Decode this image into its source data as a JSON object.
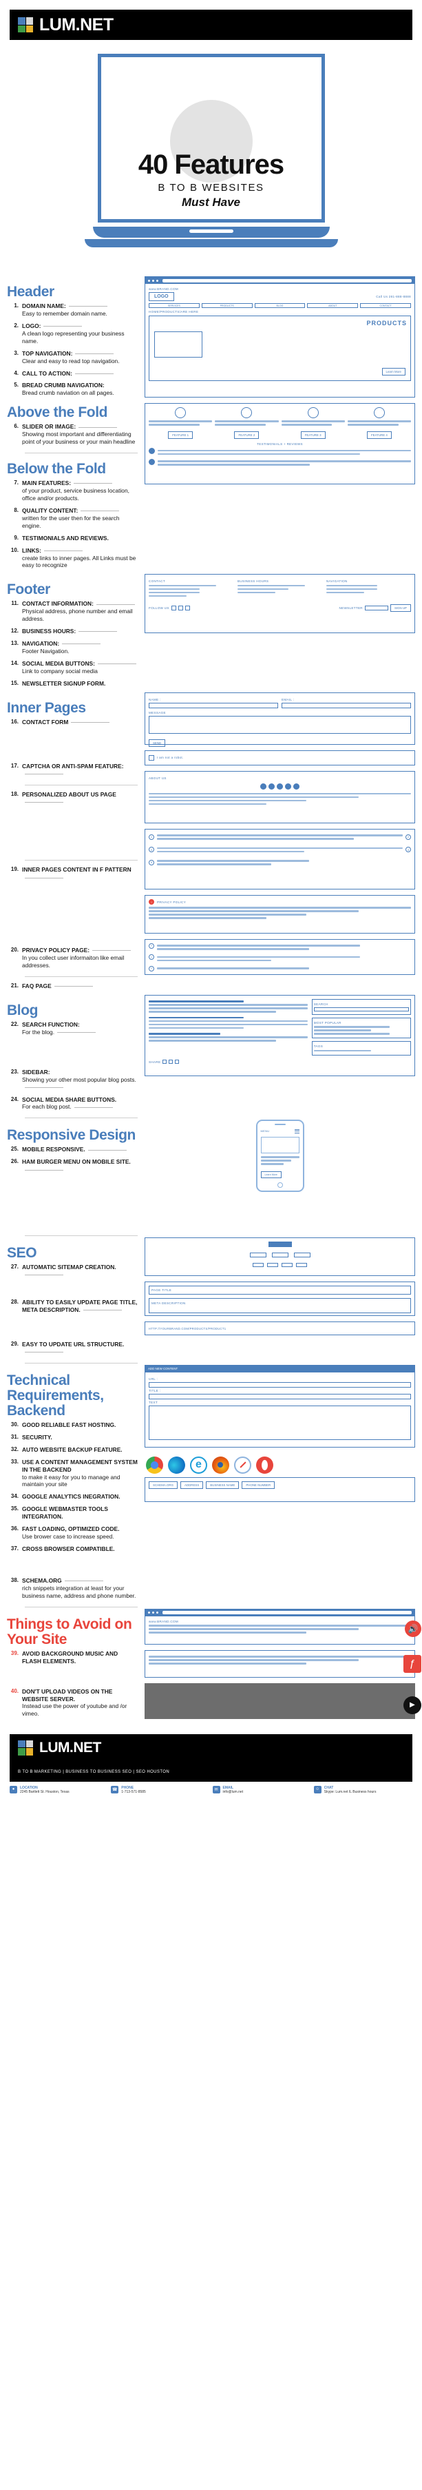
{
  "brand": {
    "name": "LUM.NET",
    "logo_icon": "lumnet-squares-logo",
    "tagline": "B TO B MARKETING | BUSINESS TO BUSINESS SEO | SEO HOUSTON"
  },
  "hero": {
    "title": "40 Features",
    "subtitle": "B TO B WEBSITES",
    "subtitle2": "Must Have"
  },
  "sections": [
    {
      "id": "header",
      "title": "Header",
      "items": [
        {
          "num": "1.",
          "title": "DOMAIN NAME:",
          "desc": "Easy to remember domain name."
        },
        {
          "num": "2.",
          "title": "LOGO:",
          "desc": "A clean logo representing your business name."
        },
        {
          "num": "3.",
          "title": "TOP NAVIGATION:",
          "desc": "Clear and easy to read top navigation."
        },
        {
          "num": "4.",
          "title": "CALL TO ACTION:",
          "desc": ""
        },
        {
          "num": "5.",
          "title": "BREAD CRUMB NAVIGATION:",
          "desc": "Bread crumb naviation on all pages."
        }
      ]
    },
    {
      "id": "above-the-fold",
      "title": "Above the Fold",
      "items": [
        {
          "num": "6.",
          "title": "SLIDER OR IMAGE:",
          "desc": "Showing most important and differentiating point of your business or your main headline"
        }
      ]
    },
    {
      "id": "below-the-fold",
      "title": "Below the Fold",
      "items": [
        {
          "num": "7.",
          "title": "MAIN FEATURES:",
          "desc": "of your product, service business location, office and/or products."
        },
        {
          "num": "8.",
          "title": "QUALITY CONTENT:",
          "desc": "written for the user then for the search engine."
        },
        {
          "num": "9.",
          "title": "TESTIMONIALS AND REVIEWS.",
          "desc": ""
        },
        {
          "num": "10.",
          "title": "LINKS:",
          "desc": "create links to inner pages. All Links must be easy to recognize"
        }
      ]
    },
    {
      "id": "footer",
      "title": "Footer",
      "items": [
        {
          "num": "11.",
          "title": "CONTACT INFORMATION:",
          "desc": "Physical address, phone number and email address."
        },
        {
          "num": "12.",
          "title": "BUSINESS HOURS:",
          "desc": ""
        },
        {
          "num": "13.",
          "title": "NAVIGATION:",
          "desc": "Footer Navigation."
        },
        {
          "num": "14.",
          "title": "SOCIAL MEDIA BUTTONS:",
          "desc": "Link to company social media"
        },
        {
          "num": "15.",
          "title": "NEWSLETTER SIGNUP FORM.",
          "desc": ""
        }
      ]
    },
    {
      "id": "inner-pages",
      "title": "Inner Pages",
      "items": [
        {
          "num": "16.",
          "title": "CONTACT FORM",
          "desc": ""
        },
        {
          "num": "17.",
          "title": "CAPTCHA OR ANTI-SPAM FEATURE:",
          "desc": ""
        },
        {
          "num": "18.",
          "title": "PERSONALIZED ABOUT US PAGE",
          "desc": ""
        },
        {
          "num": "19.",
          "title": "INNER PAGES CONTENT IN F PATTERN",
          "desc": ""
        },
        {
          "num": "20.",
          "title": "PRIVACY POLICY PAGE:",
          "desc": "In you collect user informaiton like email addresses."
        },
        {
          "num": "21.",
          "title": "FAQ PAGE",
          "desc": ""
        }
      ]
    },
    {
      "id": "blog",
      "title": "Blog",
      "items": [
        {
          "num": "22.",
          "title": "SEARCH FUNCTION:",
          "desc": "For the blog."
        },
        {
          "num": "23.",
          "title": "SIDEBAR:",
          "desc": "Showing your other most popular blog posts."
        },
        {
          "num": "24.",
          "title": "SOCIAL MEDIA SHARE BUTTONS.",
          "desc": "For each blog post."
        }
      ]
    },
    {
      "id": "responsive-design",
      "title": "Responsive Design",
      "items": [
        {
          "num": "25.",
          "title": "MOBILE RESPONSIVE.",
          "desc": ""
        },
        {
          "num": "26.",
          "title": "HAM BURGER MENU ON MOBILE SITE.",
          "desc": ""
        }
      ]
    },
    {
      "id": "seo",
      "title": "SEO",
      "items": [
        {
          "num": "27.",
          "title": "AUTOMATIC SITEMAP CREATION.",
          "desc": ""
        },
        {
          "num": "28.",
          "title": "ABILITY TO EASILY UPDATE PAGE TITLE, META DESCRIPTION.",
          "desc": ""
        },
        {
          "num": "29.",
          "title": "EASY TO UPDATE URL STRUCTURE.",
          "desc": ""
        }
      ]
    },
    {
      "id": "technical-requirements",
      "title": "Technical Requirements, Backend",
      "items": [
        {
          "num": "30.",
          "title": "GOOD RELIABLE FAST HOSTING.",
          "desc": ""
        },
        {
          "num": "31.",
          "title": "SECURITY.",
          "desc": ""
        },
        {
          "num": "32.",
          "title": "AUTO WEBSITE BACKUP FEATURE.",
          "desc": ""
        },
        {
          "num": "33.",
          "title": "USE A CONTENT MANAGEMENT SYSTEM IN THE BACKEND",
          "desc": "to make it easy for you to manage and maintain your site"
        },
        {
          "num": "34.",
          "title": "GOOGLE ANALYTICS INEGRATION.",
          "desc": ""
        },
        {
          "num": "35.",
          "title": "GOOGLE WEBMASTER TOOLS INTEGRATION.",
          "desc": ""
        },
        {
          "num": "36.",
          "title": "FAST LOADING, OPTIMIZED CODE.",
          "desc": "Use brower case to increase speed."
        },
        {
          "num": "37.",
          "title": "CROSS BROWSER COMPATIBLE.",
          "desc": ""
        },
        {
          "num": "38.",
          "title": "SCHEMA.ORG",
          "desc": "rich snippets integration at least for your business name, address and phone number."
        }
      ]
    },
    {
      "id": "things-to-avoid",
      "title": "Things to Avoid on Your Site",
      "danger": true,
      "items": [
        {
          "num": "39.",
          "title": "AVOID BACKGROUND MUSIC AND FLASH ELEMENTS.",
          "desc": ""
        },
        {
          "num": "40.",
          "title": "DON'T UPLOAD VIDEOS ON THE WEBSITE SERVER.",
          "desc": "Instead use the power of youtube and /or vimeo."
        }
      ]
    }
  ],
  "wireframes": {
    "url": "www.BRAND.COM",
    "logo": "LOGO",
    "cta": "Call Us 281-888-8888",
    "nav": [
      "SERVICES",
      "PRODUCTS",
      "BLOG",
      "ABOUT",
      "CONTACT"
    ],
    "breadcrumb": "HOME/PRODUCTS/ARE HERE",
    "hero_word": "PRODUCTS",
    "learn_more": "Learn More",
    "features": [
      "FEATURE 1",
      "FEATURE 2",
      "FEATURE 3",
      "FEATURE 4"
    ],
    "testimonials": "TESTIMONIALS + REVIEWS",
    "footer_contact": "CONTACT",
    "footer_hours": "BUSINESS HOURS",
    "footer_nav": "NAVIGATION",
    "follow": "FOLLOW US",
    "newsletter": "NEWSLETTER",
    "signup": "SIGN UP",
    "name_label": "NAME :",
    "email_label": "EMAIL :",
    "message_label": "MESSAGE",
    "send": "SEND",
    "robot_check": "I am not a robot.",
    "about_us": "ABOUT US",
    "privacy": "PRIVACY POLICY",
    "search": "SEARCH",
    "popular": "MOST POPULAR",
    "tags": "TAGS",
    "share": "SHARE",
    "menu": "MENU",
    "page_title": "PAGE TITLE",
    "meta_description": "META DESCRIPTION",
    "url_structure": "HTTP://YOURBRAND.COM/PRODUCTS/PRODUCT1",
    "cms": "ADD NEW CONTENT",
    "cms_url": "URL :",
    "cms_title": "TITLE :",
    "cms_text": "TEXT",
    "schema_tags": [
      "SCHEMA.ORG",
      "ADDRESS",
      "BUSINESS NAME",
      "PHONE NUMBER"
    ]
  },
  "browsers": [
    "chrome-icon",
    "edge-icon",
    "firefox-icon",
    "internet-explorer-icon",
    "safari-icon",
    "opera-icon"
  ],
  "footer_info": [
    {
      "icon": "location-pin-icon",
      "title": "LOCATION",
      "lines": "2245 Bartlett St.\nHouston, Texas"
    },
    {
      "icon": "phone-icon",
      "title": "PHONE",
      "lines": "1-713-571-8585"
    },
    {
      "icon": "email-icon",
      "title": "EMAIL",
      "lines": "info@lum.net"
    },
    {
      "icon": "chat-icon",
      "title": "CHAT",
      "lines": "Skype: Lum.net IL\nBusiness hours"
    }
  ],
  "colors": {
    "brand_blue": "#4a7ebb",
    "danger_red": "#e8453c",
    "black": "#000000"
  }
}
